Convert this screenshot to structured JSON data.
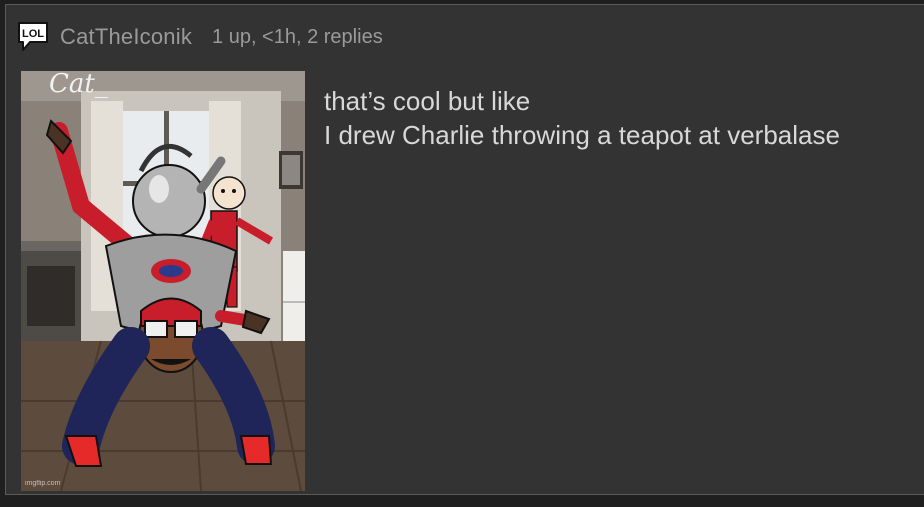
{
  "post": {
    "author": "CatTheIconik",
    "meta": "1 up, <1h, 2 replies",
    "lines": [
      "that’s cool but like",
      "I drew Charlie throwing a teapot at verbalase"
    ]
  },
  "icons": {
    "reply_type": "lol-speech-bubble-icon",
    "badge_text": "LOL"
  },
  "image": {
    "subject": "drawing of a character in red, gray and navy clothing mid-throw with a silver teapot, overlaid on a kitchen photo",
    "handwriting": "Cat_",
    "watermark": "imgflip.com"
  },
  "colors": {
    "background": "#333333",
    "text_primary": "#d8d8d8",
    "text_secondary": "#9a9a9a"
  }
}
